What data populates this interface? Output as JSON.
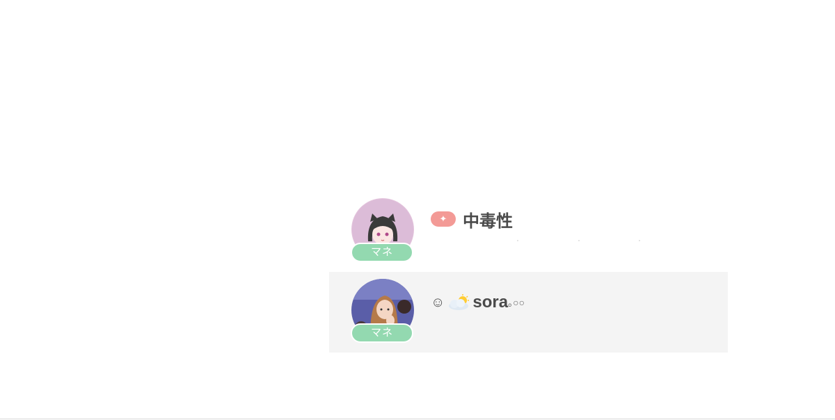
{
  "list": {
    "items": [
      {
        "name": "中毒性",
        "badge_label": "マネ",
        "icon": "sparkle-pill-icon",
        "avatar_icon": "anime-girl-avatar",
        "selected": false
      },
      {
        "name_prefix": "☺",
        "name_emoji": "sun-behind-cloud-icon",
        "name": "sora",
        "name_suffix": "｡○○",
        "badge_label": "マネ",
        "avatar_icon": "photo-girl-avatar",
        "selected": true
      }
    ]
  },
  "colors": {
    "badge": "#93d9b0",
    "pill": "#f39a96",
    "selected_row_bg": "#f4f4f4",
    "name_text": "#4a4a4a"
  }
}
